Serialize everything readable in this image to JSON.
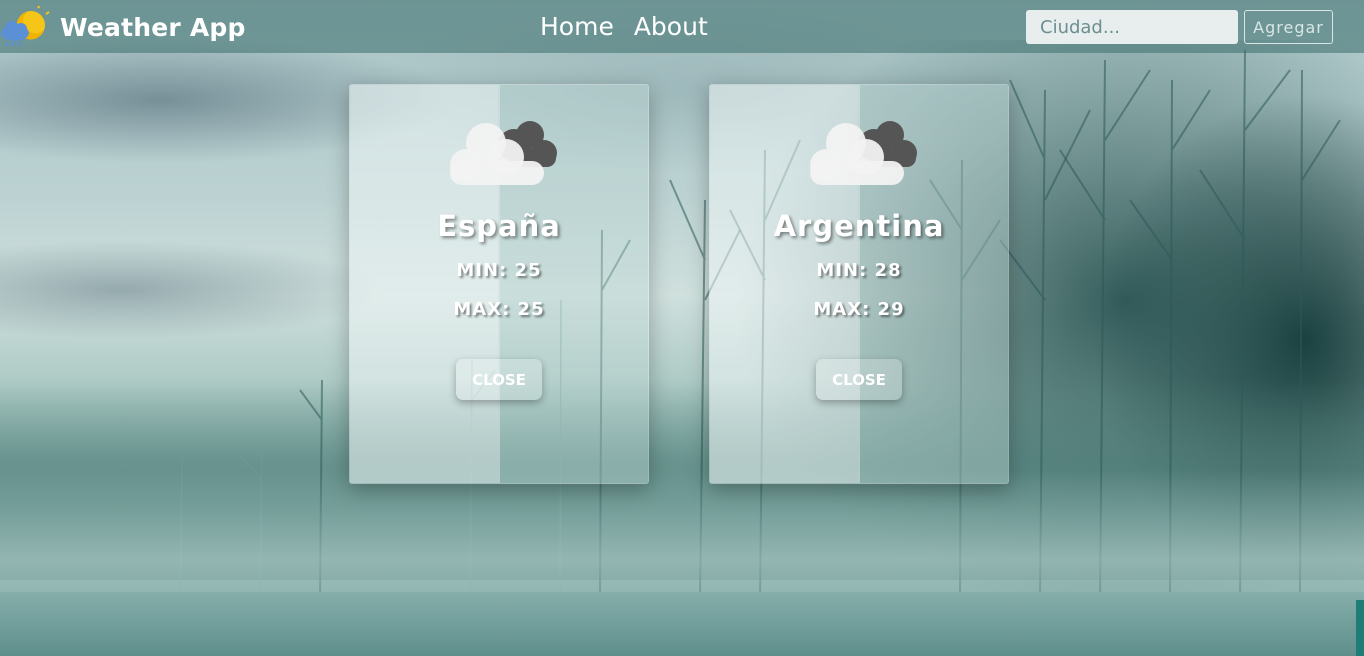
{
  "app": {
    "title": "Weather App"
  },
  "nav": {
    "links": [
      "Home",
      "About"
    ]
  },
  "search": {
    "placeholder": "Ciudad...",
    "value": "",
    "add_label": "Agregar"
  },
  "cards": [
    {
      "city": "España",
      "min": "MIN: 25",
      "max": "MAX: 25",
      "close_label": "CLOSE",
      "icon": "cloud-icon"
    },
    {
      "city": "Argentina",
      "min": "MIN: 28",
      "max": "MAX: 29",
      "close_label": "CLOSE",
      "icon": "cloud-icon"
    }
  ],
  "colors": {
    "navbar": "#3c6e6c",
    "text": "#ffffff",
    "input_bg": "#e8eeee",
    "cloud_light": "#f2f2f2",
    "cloud_dark": "#555555",
    "sun": "#f5c518"
  }
}
